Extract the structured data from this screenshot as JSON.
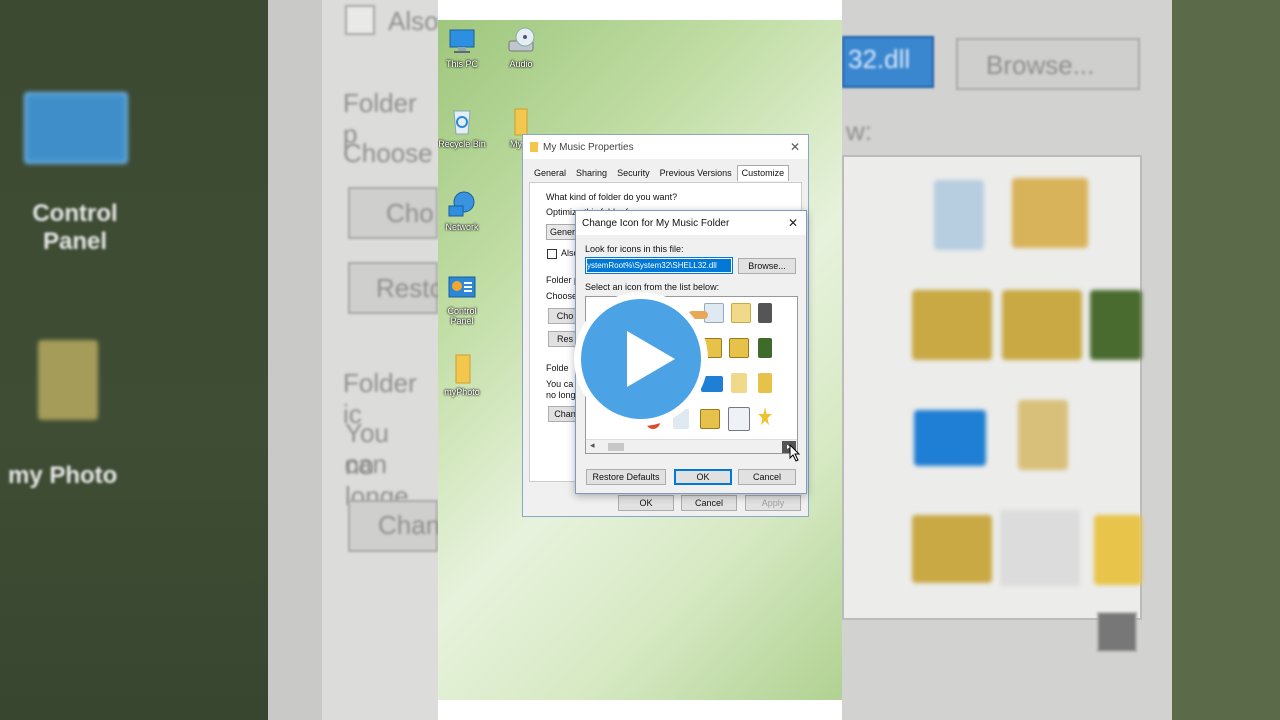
{
  "background_left": {
    "also_label": "Also",
    "folder_p_label": "Folder p",
    "choose_label": "Choose",
    "cho_btn": "Cho",
    "resto_btn": "Resto",
    "folder_ic_label": "Folder ic",
    "you_can_label": "You can",
    "no_longer_label": "no longe",
    "chan_btn": "Chan",
    "control_panel_label": "Control Panel",
    "my_photo_label": "my Photo"
  },
  "background_right": {
    "dll_field": "32.dll",
    "browse_btn": "Browse...",
    "list_label": "w:"
  },
  "desktop": {
    "icons": [
      {
        "label": "This PC"
      },
      {
        "label": "Audio"
      },
      {
        "label": "Recycle Bin"
      },
      {
        "label": "My M"
      },
      {
        "label": "Network"
      },
      {
        "label": "Control Panel"
      },
      {
        "label": "myPhoto"
      }
    ]
  },
  "properties": {
    "title": "My Music Properties",
    "tabs": [
      "General",
      "Sharing",
      "Security",
      "Previous Versions",
      "Customize"
    ],
    "active_tab": "Customize",
    "what_kind": "What kind of folder do you want?",
    "optimize": "Optimize this folder for:",
    "general_select": "General",
    "also_apply": "Also",
    "folder_pictures": "Folder p",
    "choose_file": "Choose",
    "choose_btn": "Cho",
    "restore_btn": "Res",
    "folder_icons": "Folde",
    "you_can": "You ca",
    "no_longer": "no long",
    "change_btn": "Chan",
    "ok": "OK",
    "cancel": "Cancel",
    "apply": "Apply"
  },
  "change_icon": {
    "title": "Change Icon for My Music Folder",
    "look_for_label": "Look for icons in this file:",
    "file_value": "ystemRoot%\\System32\\SHELL32.dll",
    "browse": "Browse...",
    "select_label": "Select an icon from the list below:",
    "restore_defaults": "Restore Defaults",
    "ok": "OK",
    "cancel": "Cancel"
  },
  "colors": {
    "play_blue": "#4ba3e6",
    "accent": "#0078d7"
  }
}
